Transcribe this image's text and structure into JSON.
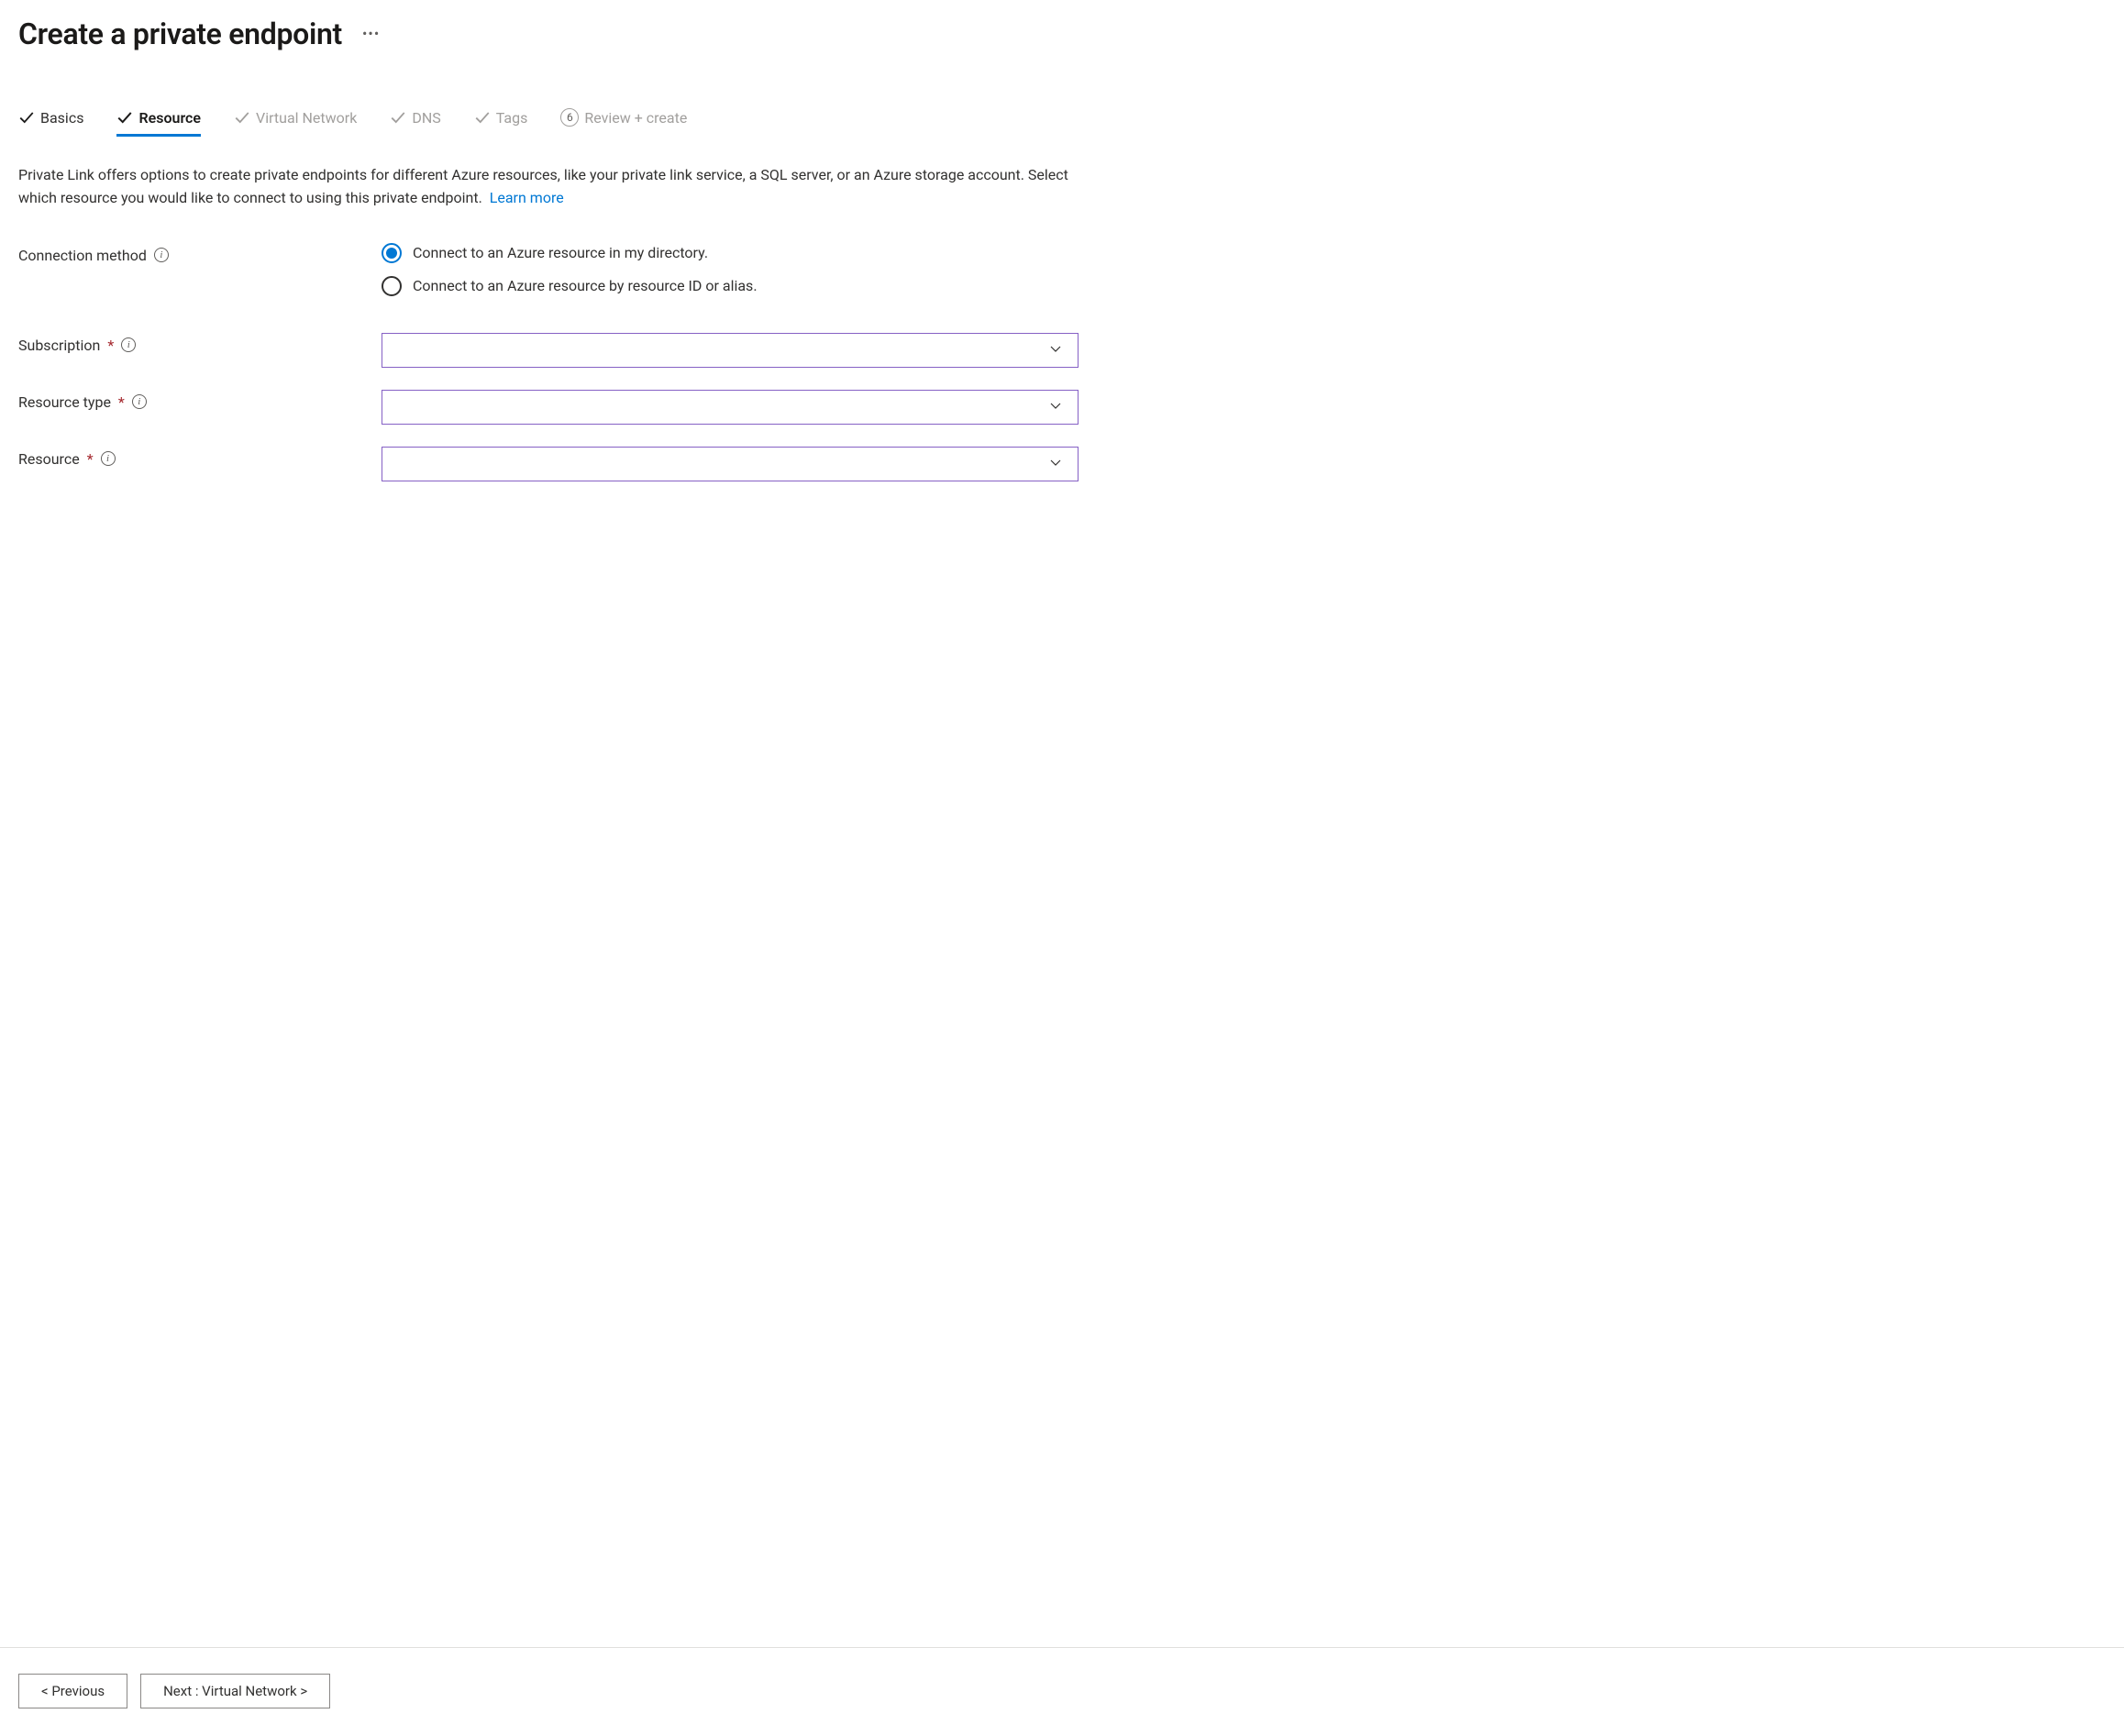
{
  "header": {
    "title": "Create a private endpoint"
  },
  "tabs": [
    {
      "label": "Basics",
      "state": "completed"
    },
    {
      "label": "Resource",
      "state": "active"
    },
    {
      "label": "Virtual Network",
      "state": "inactive"
    },
    {
      "label": "DNS",
      "state": "inactive"
    },
    {
      "label": "Tags",
      "state": "inactive"
    },
    {
      "label": "Review + create",
      "state": "numbered",
      "number": "6"
    }
  ],
  "description": {
    "text": "Private Link offers options to create private endpoints for different Azure resources, like your private link service, a SQL server, or an Azure storage account. Select which resource you would like to connect to using this private endpoint.",
    "link": "Learn more"
  },
  "connection_method": {
    "label": "Connection method",
    "options": [
      {
        "label": "Connect to an Azure resource in my directory.",
        "selected": true
      },
      {
        "label": "Connect to an Azure resource by resource ID or alias.",
        "selected": false
      }
    ]
  },
  "fields": {
    "subscription": {
      "label": "Subscription",
      "value": ""
    },
    "resource_type": {
      "label": "Resource type",
      "value": ""
    },
    "resource": {
      "label": "Resource",
      "value": ""
    }
  },
  "footer": {
    "previous": "< Previous",
    "next": "Next : Virtual Network >"
  }
}
